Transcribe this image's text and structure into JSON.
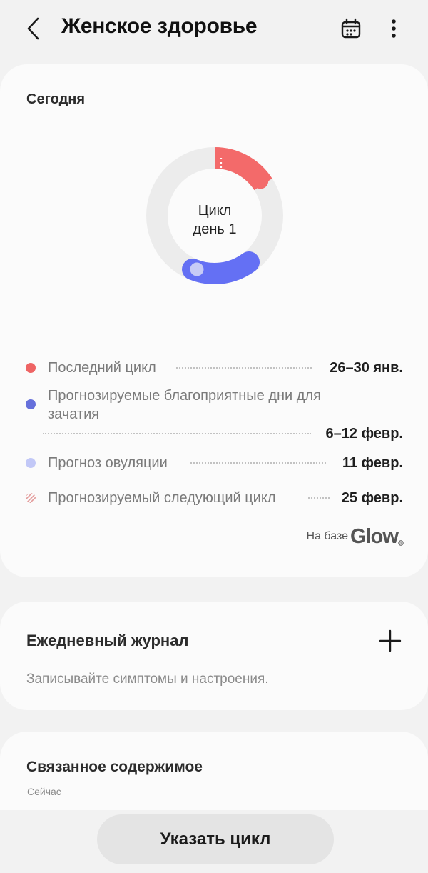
{
  "header": {
    "title": "Женское здоровье",
    "back_icon": "chevron-left-icon",
    "calendar_icon": "calendar-icon",
    "more_icon": "more-vertical-icon"
  },
  "today": {
    "title": "Сегодня",
    "ring": {
      "line1": "Цикл",
      "line2": "день 1",
      "current_day": 1
    },
    "legend": [
      {
        "label": "Последний цикл",
        "value": "26–30 янв.",
        "color": "#ee6464"
      },
      {
        "label_line1": "Прогнозируемые благоприятные дни для",
        "label_line2": "зачатия",
        "value": "6–12 февр.",
        "color": "#6670db"
      },
      {
        "label": "Прогноз овуляции",
        "value": "11 февр.",
        "color": "#c2c8f7"
      },
      {
        "label": "Прогнозируемый следующий цикл",
        "value": "25 февр.",
        "color": "#e6a3a3"
      }
    ],
    "powered_by": "На базе",
    "brand": "Glow"
  },
  "colors": {
    "period": "#f36a6a",
    "fertile": "#6470f4",
    "ovulation": "#c7cbf6",
    "ring_track": "#ececec"
  },
  "journal": {
    "title": "Ежедневный журнал",
    "subtitle": "Записывайте симптомы и настроения.",
    "add_icon": "plus-icon"
  },
  "related": {
    "title": "Связанное содержимое",
    "subtitle": "Сейчас"
  },
  "cta": {
    "label": "Указать цикл"
  }
}
